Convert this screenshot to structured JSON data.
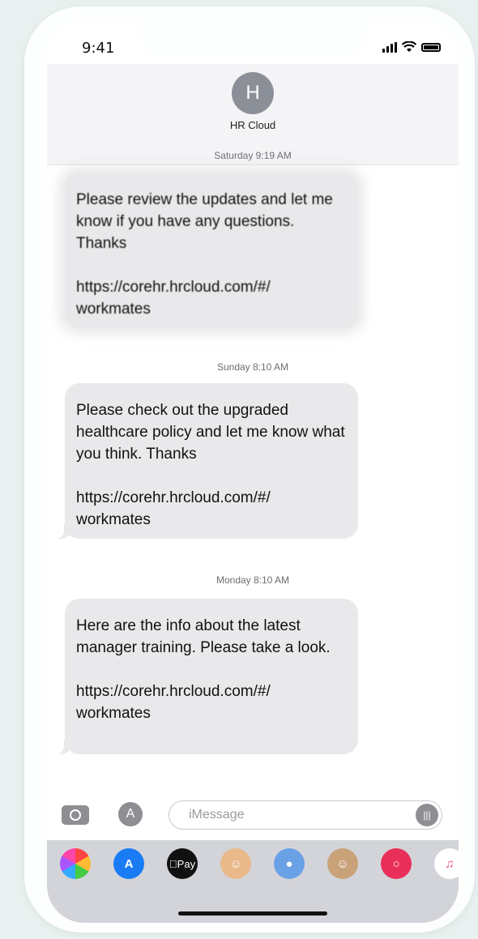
{
  "status": {
    "time": "9:41"
  },
  "contact": {
    "initial": "H",
    "name": "HR Cloud"
  },
  "messages": [
    {
      "timestamp": "Saturday 9:19 AM",
      "text": "Please review the updates and let me know if you have any questions. Thanks",
      "link": "https://corehr.hrcloud.com/#/ workmates"
    },
    {
      "timestamp": "Sunday 8:10 AM",
      "text": "Please check out the upgraded healthcare policy and let me know what you think. Thanks",
      "link": "https://corehr.hrcloud.com/#/ workmates"
    },
    {
      "timestamp": "Monday 8:10 AM",
      "text": "Here are the info about the latest manager training. Please take a look.",
      "link": "https://corehr.hrcloud.com/#/ workmates"
    }
  ],
  "input": {
    "placeholder": "iMessage"
  },
  "app_drawer": {
    "apple_pay_label": "Pay",
    "apps": [
      "photos-icon",
      "app-store-icon",
      "apple-pay-icon",
      "memoji-icon",
      "stickers-icon",
      "animoji-icon",
      "search-images-icon",
      "music-icon",
      "digital-touch-icon"
    ]
  },
  "colors": {
    "bubble": "#e9e9eb",
    "app_store": "#1a7cf5",
    "search": "#e8305a",
    "avatar": "#8b8f98"
  }
}
